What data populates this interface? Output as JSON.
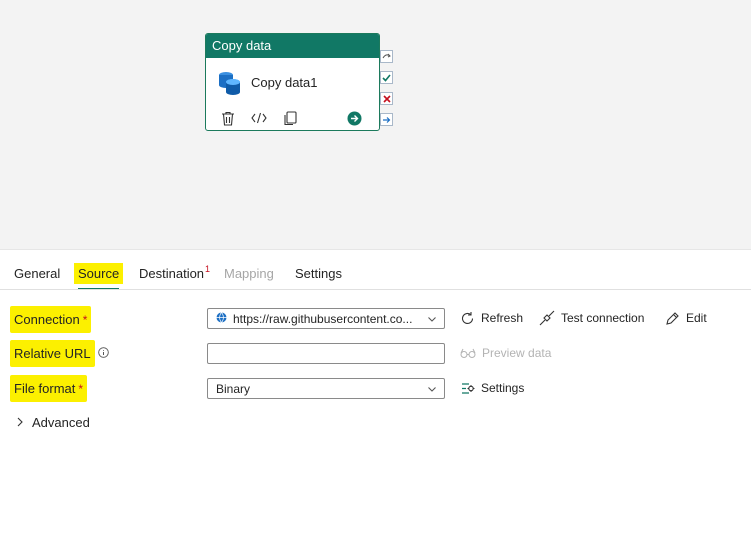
{
  "canvas": {
    "activity": {
      "type_label": "Copy data",
      "name": "Copy data1"
    }
  },
  "tabs": [
    {
      "label": "General"
    },
    {
      "label": "Source",
      "active": true
    },
    {
      "label": "Destination",
      "badge": "1"
    },
    {
      "label": "Mapping",
      "disabled": true
    },
    {
      "label": "Settings"
    }
  ],
  "form": {
    "connection": {
      "label": "Connection",
      "required_mark": "*",
      "value": "https://raw.githubusercontent.co..."
    },
    "relative_url": {
      "label": "Relative URL",
      "value": ""
    },
    "file_format": {
      "label": "File format",
      "required_mark": "*",
      "value": "Binary"
    },
    "actions": {
      "refresh": "Refresh",
      "test_connection": "Test connection",
      "edit": "Edit",
      "preview_data": "Preview data",
      "settings": "Settings"
    },
    "advanced": "Advanced"
  },
  "colors": {
    "accent": "#117865",
    "highlight": "#fcf000",
    "required": "#c50f1f"
  }
}
